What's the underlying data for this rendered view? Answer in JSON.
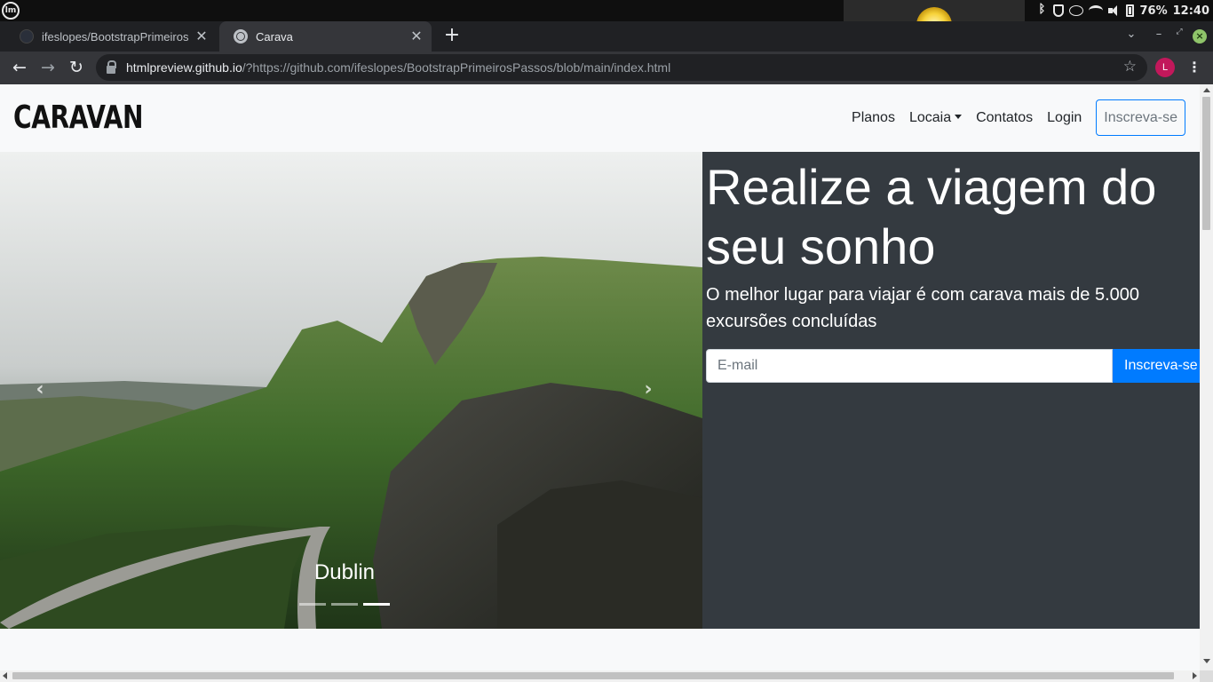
{
  "os": {
    "logo_text": "lm",
    "battery": "76%",
    "clock": "12:40"
  },
  "browser": {
    "tabs": [
      {
        "title": "ifeslopes/BootstrapPrimeiros",
        "active": false
      },
      {
        "title": "Carava",
        "active": true
      }
    ],
    "new_tab_label": "+",
    "close_glyph": "✕",
    "url_host": "htmlpreview.github.io",
    "url_rest": "/?https://github.com/ifeslopes/BootstrapPrimeirosPassos/blob/main/index.html",
    "profile_initial": "L",
    "back_glyph": "←",
    "forward_glyph": "→",
    "reload_glyph": "↻",
    "star_glyph": "☆",
    "menu_glyph": "⋮"
  },
  "navbar": {
    "brand": "CARAVAN",
    "links": [
      "Planos",
      "Locaia",
      "Contatos",
      "Login"
    ],
    "cta": "Inscreva-se"
  },
  "carousel": {
    "caption": "Dublin",
    "prev_glyph": "‹",
    "next_glyph": "›",
    "slide_count": 3,
    "active_index": 2
  },
  "hero": {
    "title": "Realize a viagem do seu sonho",
    "lead": "O melhor lugar para viajar é com carava mais de 5.000 excursões concluídas",
    "email_placeholder": "E-mail",
    "button": "Inscreva-se",
    "background": "#343a40",
    "button_color": "#007bff"
  }
}
